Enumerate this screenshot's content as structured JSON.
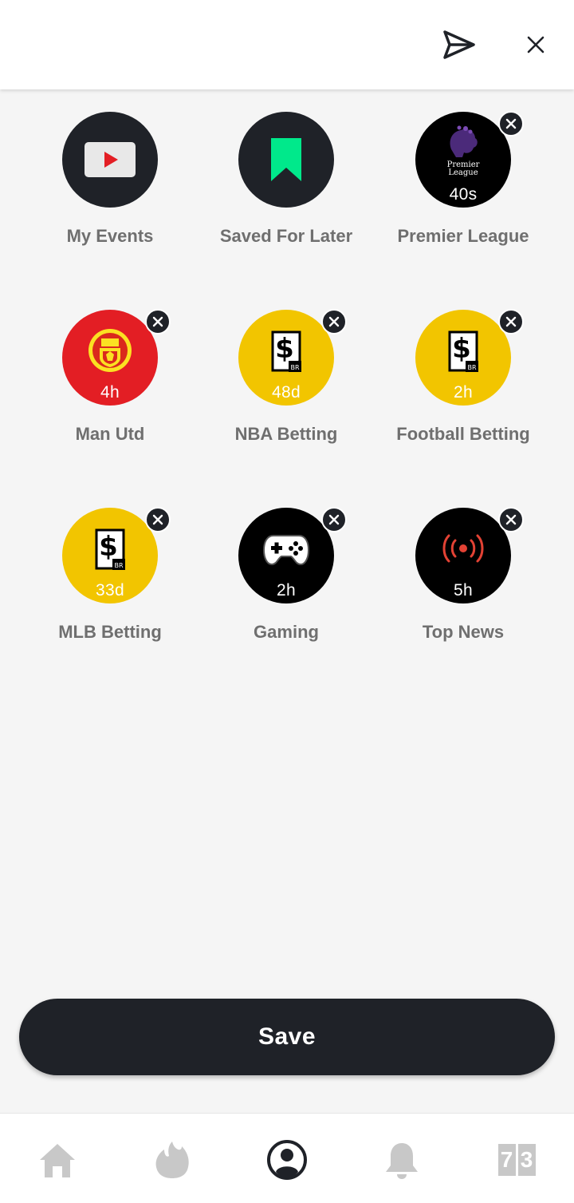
{
  "colors": {
    "dark": "#1f2228",
    "black": "#000000",
    "yellow": "#f2c500",
    "red": "#e31e24",
    "green": "#00e98b",
    "label": "#6f6f6f",
    "nav_inactive": "#c8c8c8"
  },
  "header": {
    "share_icon": "paper-plane-icon",
    "close_icon": "close-icon"
  },
  "tiles": [
    {
      "label": "My Events",
      "time": "",
      "icon": "play-video-icon",
      "removable": false
    },
    {
      "label": "Saved For Later",
      "time": "",
      "icon": "bookmark-icon",
      "removable": false
    },
    {
      "label": "Premier League",
      "time": "40s",
      "icon": "premier-league-logo-icon",
      "removable": true
    },
    {
      "label": "Man Utd",
      "time": "4h",
      "icon": "man-utd-crest-icon",
      "removable": true
    },
    {
      "label": "NBA Betting",
      "time": "48d",
      "icon": "br-betting-icon",
      "removable": true
    },
    {
      "label": "Football Betting",
      "time": "2h",
      "icon": "br-betting-icon",
      "removable": true
    },
    {
      "label": "MLB Betting",
      "time": "33d",
      "icon": "br-betting-icon",
      "removable": true
    },
    {
      "label": "Gaming",
      "time": "2h",
      "icon": "gamepad-icon",
      "removable": true
    },
    {
      "label": "Top News",
      "time": "5h",
      "icon": "broadcast-icon",
      "removable": true
    }
  ],
  "save_label": "Save",
  "nav": {
    "items": [
      "home-icon",
      "flame-icon",
      "profile-icon",
      "bell-icon",
      "scores-icon"
    ],
    "active": "profile-icon",
    "score_digits": [
      "7",
      "3"
    ]
  }
}
